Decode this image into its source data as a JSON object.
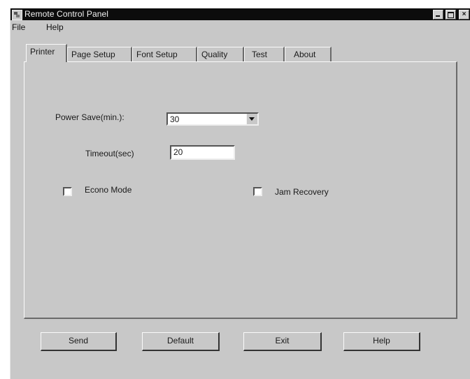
{
  "window": {
    "title": "Remote Control Panel"
  },
  "menu": {
    "file": "File",
    "help": "Help"
  },
  "tabs": [
    {
      "label": "Printer",
      "active": true
    },
    {
      "label": "Page Setup",
      "active": false
    },
    {
      "label": "Font Setup",
      "active": false
    },
    {
      "label": "Quality",
      "active": false
    },
    {
      "label": "Test",
      "active": false
    },
    {
      "label": "About",
      "active": false
    }
  ],
  "printer": {
    "power_save_label": "Power Save(min.):",
    "power_save_value": "30",
    "timeout_label": "Timeout(sec)",
    "timeout_value": "20",
    "econo_mode_label": "Econo Mode",
    "econo_mode_checked": false,
    "jam_recovery_label": "Jam Recovery",
    "jam_recovery_checked": false
  },
  "buttons": {
    "send": "Send",
    "default": "Default",
    "exit": "Exit",
    "help": "Help"
  }
}
